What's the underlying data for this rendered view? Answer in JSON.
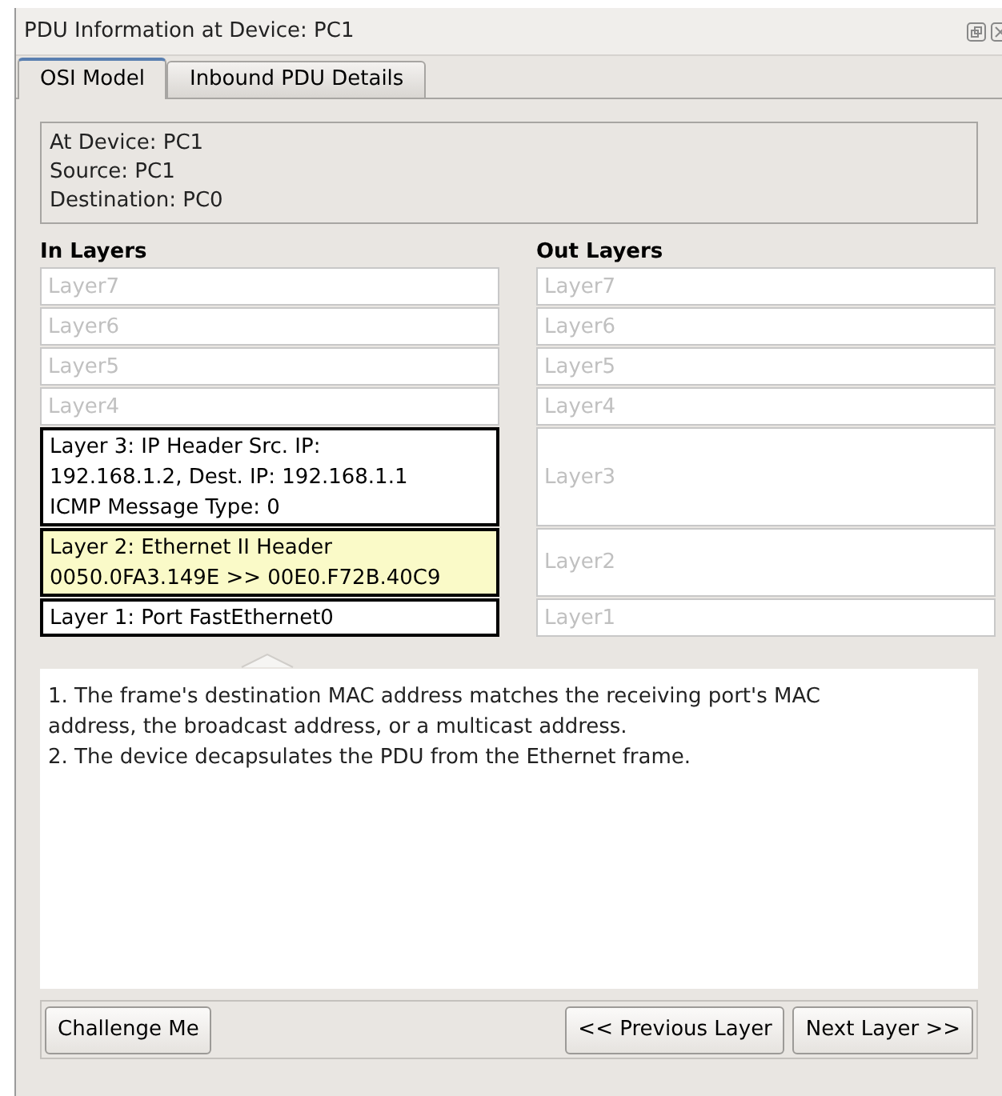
{
  "window": {
    "title": "PDU Information at Device: PC1"
  },
  "tabs": [
    {
      "label": "OSI Model",
      "selected": true
    },
    {
      "label": "Inbound PDU Details",
      "selected": false
    }
  ],
  "info": [
    "At Device: PC1",
    "Source: PC1",
    "Destination: PC0"
  ],
  "in_layers": {
    "heading": "In Layers",
    "items": [
      {
        "lines": [
          "Layer7"
        ],
        "active": false,
        "selected": false
      },
      {
        "lines": [
          "Layer6"
        ],
        "active": false,
        "selected": false
      },
      {
        "lines": [
          "Layer5"
        ],
        "active": false,
        "selected": false
      },
      {
        "lines": [
          "Layer4"
        ],
        "active": false,
        "selected": false
      },
      {
        "lines": [
          "Layer 3: IP Header Src. IP: 192.168.1.2, Dest. IP: 192.168.1.1",
          "ICMP Message Type: 0"
        ],
        "active": true,
        "selected": false
      },
      {
        "lines": [
          "Layer 2: Ethernet II Header",
          "0050.0FA3.149E >> 00E0.F72B.40C9"
        ],
        "active": true,
        "selected": true
      },
      {
        "lines": [
          "Layer 1: Port FastEthernet0"
        ],
        "active": true,
        "selected": false
      }
    ]
  },
  "out_layers": {
    "heading": "Out Layers",
    "items": [
      {
        "lines": [
          "Layer7"
        ],
        "active": false,
        "selected": false
      },
      {
        "lines": [
          "Layer6"
        ],
        "active": false,
        "selected": false
      },
      {
        "lines": [
          "Layer5"
        ],
        "active": false,
        "selected": false
      },
      {
        "lines": [
          "Layer4"
        ],
        "active": false,
        "selected": false
      },
      {
        "lines": [
          "Layer3"
        ],
        "active": false,
        "selected": false
      },
      {
        "lines": [
          "Layer2"
        ],
        "active": false,
        "selected": false
      },
      {
        "lines": [
          "Layer1"
        ],
        "active": false,
        "selected": false
      }
    ]
  },
  "description": [
    "1. The frame's destination MAC address matches the receiving port's MAC address, the broadcast address, or a multicast address.",
    "2. The device decapsulates the PDU from the Ethernet frame."
  ],
  "buttons": {
    "left": [
      "Challenge Me"
    ],
    "right": [
      "<< Previous Layer",
      "Next Layer >>"
    ]
  }
}
